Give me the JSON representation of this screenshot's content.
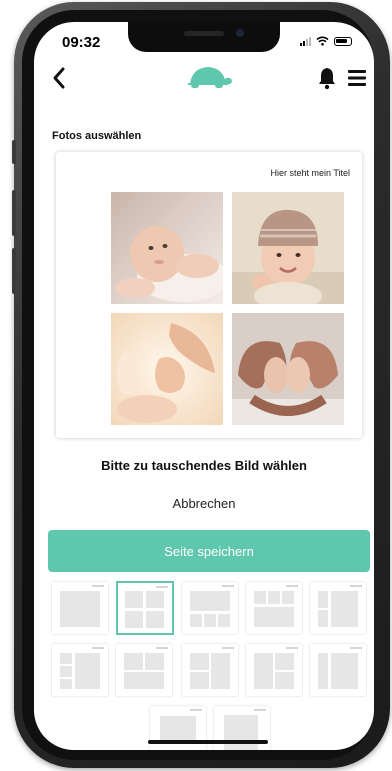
{
  "status_bar": {
    "time": "09:32"
  },
  "nav": {
    "back_icon": "chevron-left-icon",
    "logo_icon": "turtle-icon",
    "notification_icon": "bell-icon",
    "menu_icon": "hamburger-menu-icon"
  },
  "section_title": "Fotos auswählen",
  "preview": {
    "title": "Hier steht mein Titel",
    "photos": [
      "baby-lying-photo",
      "baby-hat-photo",
      "baby-hand-photo",
      "baby-feet-heart-photo"
    ]
  },
  "swap_hint": "Bitte zu tauschendes Bild wählen",
  "cancel_label": "Abbrechen",
  "save_label": "Seite speichern",
  "colors": {
    "accent": "#5fc7ad",
    "text": "#111111"
  },
  "layout_templates": {
    "selected_index": 1,
    "count": 12
  }
}
